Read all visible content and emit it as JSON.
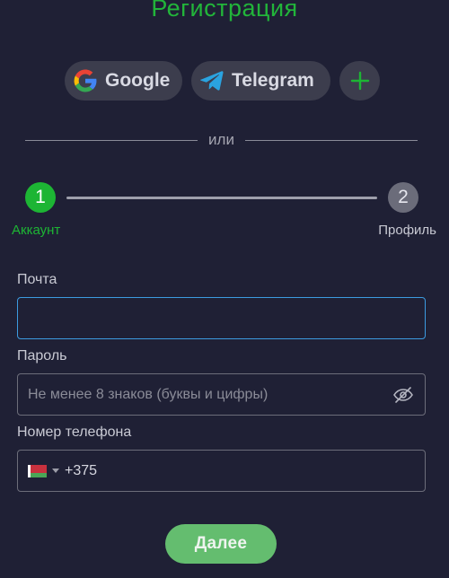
{
  "title": "Регистрация",
  "social": {
    "google_label": "Google",
    "telegram_label": "Telegram",
    "more_icon": "plus-icon"
  },
  "divider_text": "или",
  "steps": [
    {
      "number": "1",
      "label": "Аккаунт",
      "state": "active"
    },
    {
      "number": "2",
      "label": "Профиль",
      "state": "inactive"
    }
  ],
  "form": {
    "email": {
      "label": "Почта",
      "value": "",
      "placeholder": ""
    },
    "password": {
      "label": "Пароль",
      "value": "",
      "placeholder": "Не менее 8 знаков (буквы и цифры)"
    },
    "phone": {
      "label": "Номер телефона",
      "value": "+375",
      "country_flag": "belarus-flag-icon"
    }
  },
  "submit_label": "Далее",
  "colors": {
    "background": "#1f2035",
    "accent_green": "#1db534",
    "button_green": "#64bd6f",
    "focus_blue": "#3c9be0",
    "chip_bg": "#3c3d4d"
  }
}
